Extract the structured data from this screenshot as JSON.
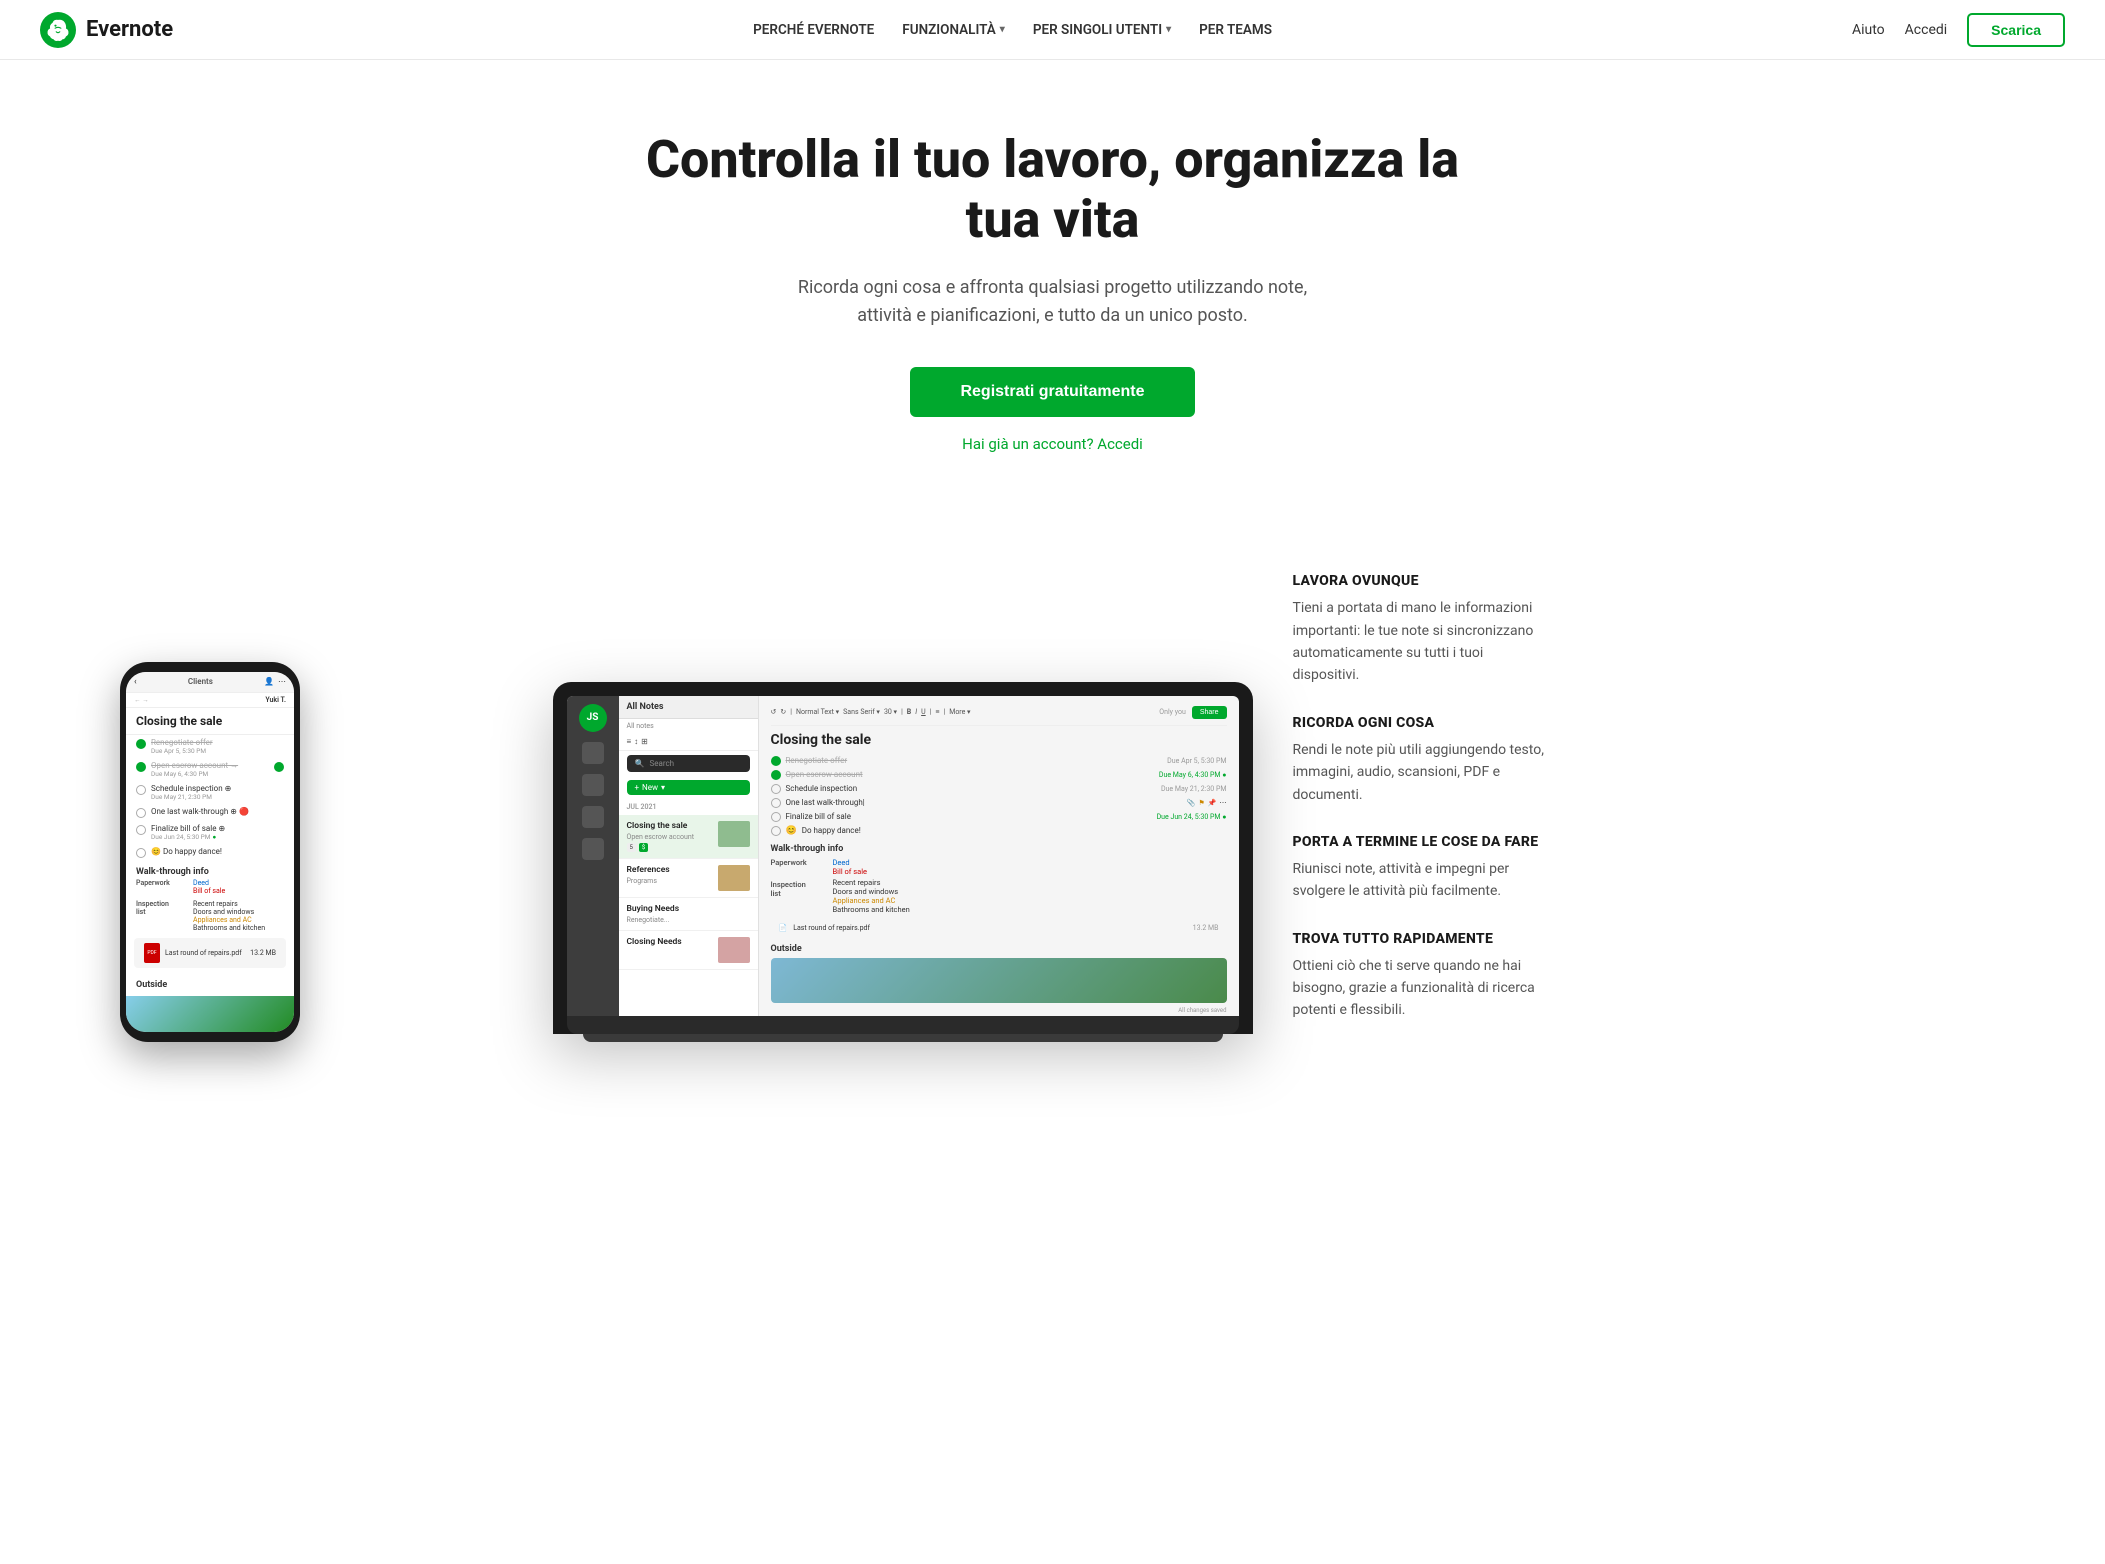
{
  "nav": {
    "logo_text": "Evernote",
    "links": [
      {
        "label": "PERCHÉ EVERNOTE",
        "has_arrow": false
      },
      {
        "label": "FUNZIONALITÀ",
        "has_arrow": true
      },
      {
        "label": "PER SINGOLI UTENTI",
        "has_arrow": true
      },
      {
        "label": "PER TEAMS",
        "has_arrow": false
      }
    ],
    "right": {
      "help": "Aiuto",
      "login": "Accedi",
      "download": "Scarica"
    }
  },
  "hero": {
    "title": "Controlla il tuo lavoro, organizza la tua vita",
    "subtitle": "Ricorda ogni cosa e affronta qualsiasi progetto utilizzando note, attività e pianificazioni, e tutto da un unico posto.",
    "cta_primary": "Registrati gratuitamente",
    "cta_secondary": "Hai già un account? Accedi"
  },
  "app": {
    "all_notes_label": "All Notes",
    "search_placeholder": "Search",
    "new_btn": "New",
    "section_date": "JUL 2021",
    "note_title": "Closing the sale",
    "tasks": [
      {
        "text": "Renegotiate offer",
        "done": true,
        "date": "Due Apr 5, 5:30 PM",
        "date_color": "normal"
      },
      {
        "text": "Open escrow account",
        "done": true,
        "date": "Due May 6, 4:30 PM",
        "date_color": "green"
      },
      {
        "text": "Schedule inspection",
        "done": false,
        "date": "Due May 21, 2:30 PM",
        "date_color": "normal"
      },
      {
        "text": "One last walk-through",
        "done": false,
        "date": "",
        "date_color": "normal"
      },
      {
        "text": "Finalize bill of sale",
        "done": false,
        "date": "Due Jun 24, 5:30 PM",
        "date_color": "green"
      },
      {
        "text": "Do happy dance!",
        "done": false,
        "date": "",
        "date_color": "normal"
      }
    ],
    "walk_through_section": "Walk-through info",
    "paperwork_label": "Paperwork",
    "paperwork_items": [
      "Deed",
      "Bill of sale"
    ],
    "inspection_label": "Inspection list",
    "inspection_items": [
      "Recent repairs",
      "Doors and windows",
      "Appliances and AC",
      "Bathrooms and kitchen"
    ],
    "pdf_name": "Last round of repairs.pdf",
    "pdf_size": "13.2 MB",
    "outside_label": "Outside"
  },
  "features": [
    {
      "title": "LAVORA OVUNQUE",
      "desc": "Tieni a portata di mano le informazioni importanti: le tue note si sincronizzano automaticamente su tutti i tuoi dispositivi."
    },
    {
      "title": "RICORDA OGNI COSA",
      "desc": "Rendi le note più utili aggiungendo testo, immagini, audio, scansioni, PDF e documenti."
    },
    {
      "title": "PORTA A TERMINE LE COSE DA FARE",
      "desc": "Riunisci note, attività e impegni per svolgere le attività più facilmente."
    },
    {
      "title": "TROVA TUTTO RAPIDAMENTE",
      "desc": "Ottieni ciò che ti serve quando ne hai bisogno, grazie a funzionalità di ricerca potenti e flessibili."
    }
  ]
}
